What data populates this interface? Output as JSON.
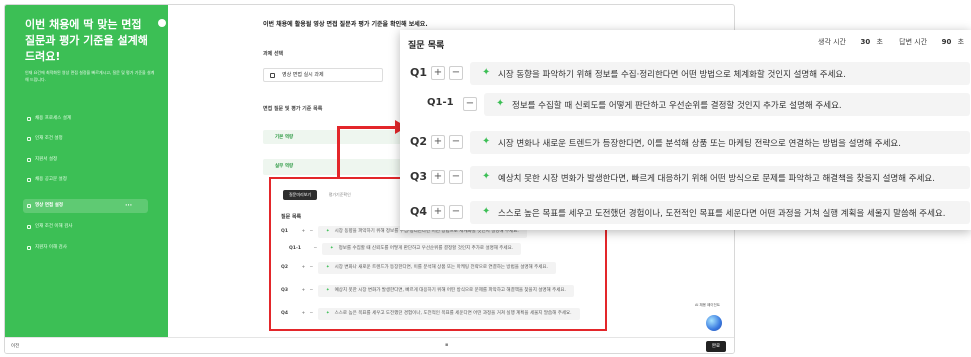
{
  "sidebar": {
    "title": "이번 채용에 딱 맞는 면접 질문과 평가 기준을 설계해 드려요!",
    "description": "인재 요건에 최적화된 영상 면접 설정을 빠르게시고, 질문 및 평가 기준을 설계해 드립니다.",
    "items": [
      {
        "label": "채용 프로세스 설계"
      },
      {
        "label": "인재 조건 설정"
      },
      {
        "label": "지원서 설정"
      },
      {
        "label": "채용 공고문 설정"
      },
      {
        "label": "영상 면접 설정",
        "active": true
      },
      {
        "label": "인재 조건 이해 검사"
      },
      {
        "label": "지원자 이해 검사"
      }
    ]
  },
  "main": {
    "heading": "이번 채용에 활용될 영상 면접 질문과 평가 기준을 확인해 보세요.",
    "assignment_label": "과제 선택",
    "assignment_value": "영상 면접 실시 과제",
    "questions_label": "면접 질문 및 평가 기준 목록",
    "band1": "기본 역량",
    "band2": "실무 역량",
    "tabs": [
      "질문미리보기",
      "평가기준확인"
    ],
    "list_title": "질문 목록",
    "bg_questions": [
      {
        "num": "Q1",
        "text": "시장 동향을 파악하기 위해 정보를 수집·정리한다면 어떤 방법으로 체계화할 것인지 설명해 주세요."
      },
      {
        "num": "Q1-1",
        "text": "정보를 수집할 때 신뢰도를 어떻게 판단하고 우선순위를 결정할 것인지 추가로 설명해 주세요."
      },
      {
        "num": "Q2",
        "text": "시장 변화나 새로운 트렌드가 등장한다면, 이를 분석해 상품 또는 마케팅 전략으로 연결하는 방법을 설명해 주세요."
      },
      {
        "num": "Q3",
        "text": "예상치 못한 시장 변화가 발생한다면, 빠르게 대응하기 위해 어떤 방식으로 문제를 파악하고 해결책을 찾을지 설명해 주세요."
      },
      {
        "num": "Q4",
        "text": "스스로 높은 목표를 세우고 도전했던 경험이나, 도전적인 목표를 세운다면 어떤 과정을 거쳐 실행 계획을 세울지 말씀해 주세요."
      }
    ],
    "ai_help": "AI 채용 페이전트"
  },
  "bottom_bar": {
    "prev": "이전",
    "done": "완료"
  },
  "overlay": {
    "title": "질문 목록",
    "questions": [
      {
        "num": "Q1",
        "text": "시장 동향을 파악하기 위해 정보를 수집·정리한다면 어떤 방법으로 체계화할 것인지 설명해 주세요.",
        "sub": false
      },
      {
        "num": "Q1-1",
        "text": "정보를 수집할 때 신뢰도를 어떻게 판단하고 우선순위를 결정할 것인지 추가로 설명해 주세요.",
        "sub": true
      },
      {
        "num": "Q2",
        "text": "시장 변화나 새로운 트렌드가 등장한다면, 이를 분석해 상품 또는 마케팅 전략으로 연결하는 방법을 설명해 주세요.",
        "sub": false
      },
      {
        "num": "Q3",
        "text": "예상치 못한 시장 변화가 발생한다면, 빠르게 대응하기 위해 어떤 방식으로 문제를 파악하고 해결책을 찾을지 설명해 주세요.",
        "sub": false
      },
      {
        "num": "Q4",
        "text": "스스로 높은 목표를 세우고 도전했던 경험이나, 도전적인 목표를 세운다면 어떤 과정을 거쳐 실행 계획을 세울지 말씀해 주세요.",
        "sub": false
      }
    ],
    "plus": "+",
    "minus": "−"
  },
  "timers": {
    "think_label": "생각 시간",
    "think_value": "30",
    "answer_label": "답변 시간",
    "answer_value": "90",
    "unit": "초"
  },
  "colors": {
    "sidebar_green": "#3cbf55",
    "highlight_red": "#e3262a",
    "sparkle_green": "#3cbf55"
  }
}
